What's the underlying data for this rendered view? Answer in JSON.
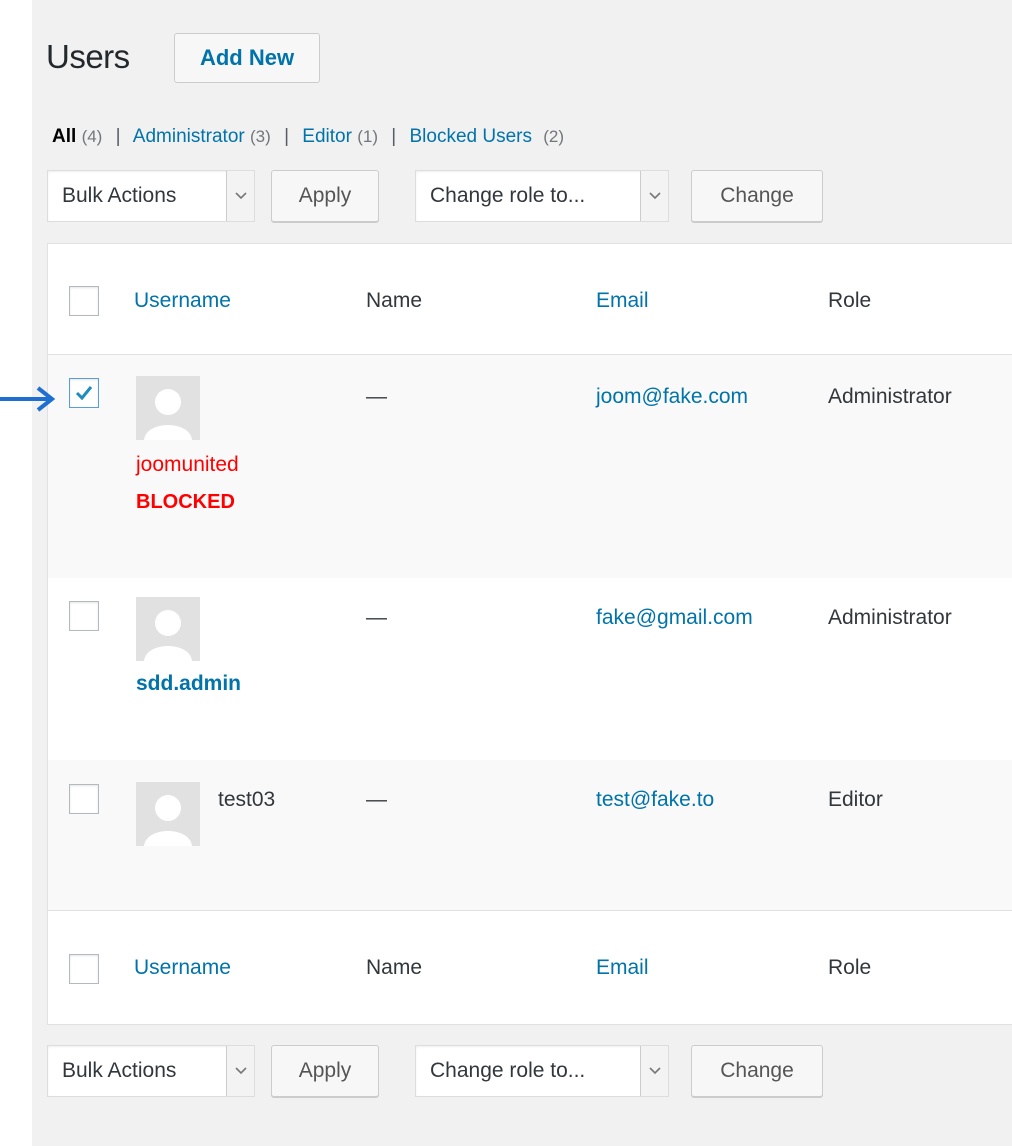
{
  "header": {
    "title": "Users",
    "add_new_label": "Add New"
  },
  "filters": [
    {
      "label": "All",
      "count": "(4)",
      "current": true
    },
    {
      "label": "Administrator",
      "count": "(3)",
      "current": false
    },
    {
      "label": "Editor",
      "count": "(1)",
      "current": false
    },
    {
      "label": "Blocked Users",
      "count": "(2)",
      "current": false
    }
  ],
  "filter_separator": "|",
  "tablenav_top": {
    "bulk_actions": "Bulk Actions",
    "apply": "Apply",
    "change_role": "Change role to...",
    "change": "Change"
  },
  "tablenav_bottom": {
    "bulk_actions": "Bulk Actions",
    "apply": "Apply",
    "change_role": "Change role to...",
    "change": "Change"
  },
  "columns": {
    "username": "Username",
    "name": "Name",
    "email": "Email",
    "role": "Role"
  },
  "rows": [
    {
      "username": "joomunited",
      "status": "BLOCKED",
      "name": "—",
      "email": "joom@fake.com",
      "role": "Administrator",
      "checked": true
    },
    {
      "username": "sdd.admin",
      "name": "—",
      "email": "fake@gmail.com",
      "role": "Administrator",
      "checked": false
    },
    {
      "username": "test03",
      "name": "—",
      "email": "test@fake.to",
      "role": "Editor",
      "checked": false
    }
  ],
  "colors": {
    "link": "#0073aa",
    "blocked": "#ff0000",
    "annotation_arrow": "#1e6fd0"
  }
}
